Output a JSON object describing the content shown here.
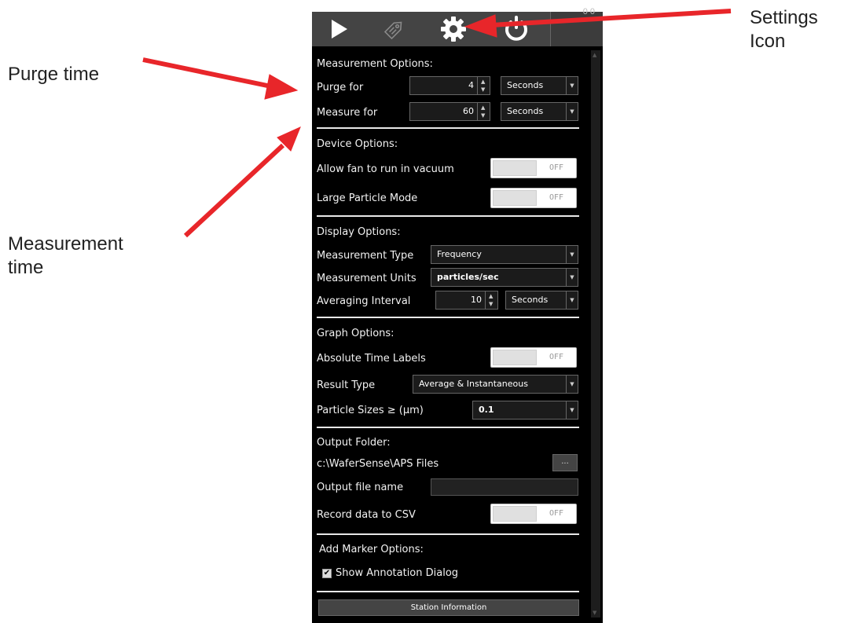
{
  "annotations": {
    "purge_time": "Purge time",
    "measurement_time": [
      "Measurement",
      "time"
    ],
    "settings_icon": [
      "Settings",
      "Icon"
    ]
  },
  "toolbar": {
    "buttons": [
      {
        "icon": "play-icon",
        "active": false
      },
      {
        "icon": "tag-icon",
        "active": false
      },
      {
        "icon": "gear-icon",
        "active": true
      },
      {
        "icon": "power-icon",
        "active": false
      }
    ],
    "corner_text": "0 0"
  },
  "measurement": {
    "header": "Measurement Options:",
    "purge_label": "Purge for",
    "purge_value": "4",
    "purge_unit": "Seconds",
    "measure_label": "Measure for",
    "measure_value": "60",
    "measure_unit": "Seconds"
  },
  "device": {
    "header": "Device Options:",
    "fan_label": "Allow fan to run in vacuum",
    "fan_state": "OFF",
    "large_particle_label": "Large Particle Mode",
    "large_particle_state": "OFF"
  },
  "display": {
    "header": "Display Options:",
    "type_label": "Measurement Type",
    "type_value": "Frequency",
    "units_label": "Measurement Units",
    "units_value": "particles/sec",
    "avg_label": "Averaging Interval",
    "avg_value": "10",
    "avg_unit": "Seconds"
  },
  "graph": {
    "header": "Graph Options:",
    "abs_time_label": "Absolute Time Labels",
    "abs_time_state": "OFF",
    "result_type_label": "Result Type",
    "result_type_value": "Average & Instantaneous",
    "particle_sizes_label": "Particle Sizes ≥ (µm)",
    "particle_sizes_value": "0.1"
  },
  "output": {
    "header": "Output Folder:",
    "folder_path": "c:\\WaferSense\\APS Files",
    "browse_label": "...",
    "file_name_label": "Output file name",
    "file_name_value": "",
    "record_csv_label": "Record data to CSV",
    "record_csv_state": "OFF"
  },
  "marker": {
    "header": "Add Marker Options:",
    "show_annotation_label": "Show Annotation Dialog",
    "show_annotation_checked": true
  },
  "station_button": "Station Information",
  "colors": {
    "arrow": "#e8262a",
    "panel_bg": "#000000",
    "toolbar_bg": "#444444"
  }
}
